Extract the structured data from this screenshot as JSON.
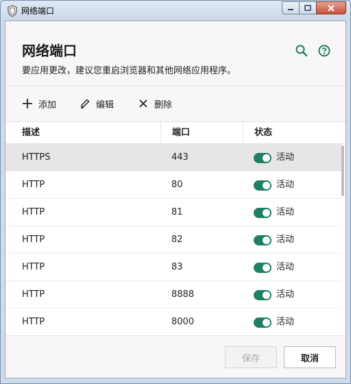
{
  "window": {
    "title": "网络端口"
  },
  "header": {
    "title": "网络端口",
    "subtitle": "要应用更改，建议您重启浏览器和其他网络应用程序。"
  },
  "toolbar": {
    "add_label": "添加",
    "edit_label": "编辑",
    "delete_label": "删除"
  },
  "table": {
    "columns": [
      "描述",
      "端口",
      "状态"
    ],
    "rows": [
      {
        "description": "HTTPS",
        "port": "443",
        "status": "活动",
        "enabled": true,
        "selected": true
      },
      {
        "description": "HTTP",
        "port": "80",
        "status": "活动",
        "enabled": true,
        "selected": false
      },
      {
        "description": "HTTP",
        "port": "81",
        "status": "活动",
        "enabled": true,
        "selected": false
      },
      {
        "description": "HTTP",
        "port": "82",
        "status": "活动",
        "enabled": true,
        "selected": false
      },
      {
        "description": "HTTP",
        "port": "83",
        "status": "活动",
        "enabled": true,
        "selected": false
      },
      {
        "description": "HTTP",
        "port": "8888",
        "status": "活动",
        "enabled": true,
        "selected": false
      },
      {
        "description": "HTTP",
        "port": "8000",
        "status": "活动",
        "enabled": true,
        "selected": false
      }
    ]
  },
  "footer": {
    "save_label": "保存",
    "cancel_label": "取消"
  },
  "colors": {
    "accent": "#1f7f64",
    "selected_row": "#e6e6e6"
  },
  "icons": {
    "search": "search-icon",
    "help": "help-icon",
    "add": "plus-icon",
    "edit": "pencil-icon",
    "delete": "close-icon"
  }
}
